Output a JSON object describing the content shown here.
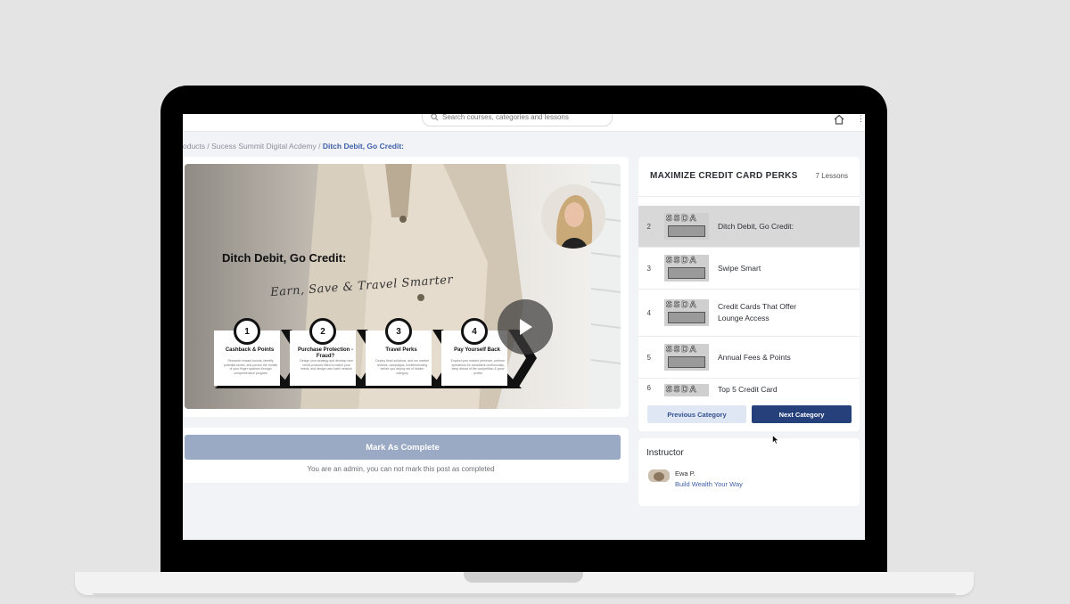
{
  "search": {
    "placeholder": "Search courses, categories and lessons"
  },
  "breadcrumb": {
    "prefix": "oducts / Sucess Summit Digital Acdemy / ",
    "current": "Ditch Debit, Go Credit:"
  },
  "video": {
    "title": "Ditch Debit, Go Credit:",
    "subtitle": "Earn, Save & Travel Smarter",
    "steps": [
      {
        "num": "1",
        "label": "Cashback & Points",
        "desc": "Research reward boosts, identify potential stores, and pursue the mobile of your finger systems through comprehensive program"
      },
      {
        "num": "2",
        "label": "Purchase Protection - Fraud?",
        "desc": "Design your strategy and develop new credit products fitted to match your needs, and design user bank network"
      },
      {
        "num": "3",
        "label": "Travel Perks",
        "desc": "Deploy fixed solutions, and run market reviews, campaigns, troubleshooting before you deploy set of hidden category"
      },
      {
        "num": "4",
        "label": "Pay Yourself Back",
        "desc": "Expand your market presence, perform operations for consistent continuously, keep ahead of the competition & grow profits"
      }
    ]
  },
  "complete": {
    "button": "Mark As Complete",
    "note": "You are an admin, you can not mark this post as completed"
  },
  "lessons": {
    "title": "MAXIMIZE CREDIT CARD PERKS",
    "count": "7 Lessons",
    "thumb_text": "SSDA",
    "items": [
      {
        "num": "2",
        "title": "Ditch Debit, Go Credit:"
      },
      {
        "num": "3",
        "title": "Swipe Smart"
      },
      {
        "num": "4",
        "title": "Credit Cards That Offer Lounge Access"
      },
      {
        "num": "5",
        "title": "Annual Fees & Points"
      },
      {
        "num": "6",
        "title": "Top 5 Credit Card"
      }
    ],
    "prev": "Previous Category",
    "next": "Next Category"
  },
  "instructor": {
    "heading": "Instructor",
    "name": "Ewa P.",
    "tagline": "Build Wealth Your Way"
  },
  "colors": {
    "accent": "#25407a",
    "link": "#3f5fa8",
    "active_row": "#d8d8d8"
  }
}
